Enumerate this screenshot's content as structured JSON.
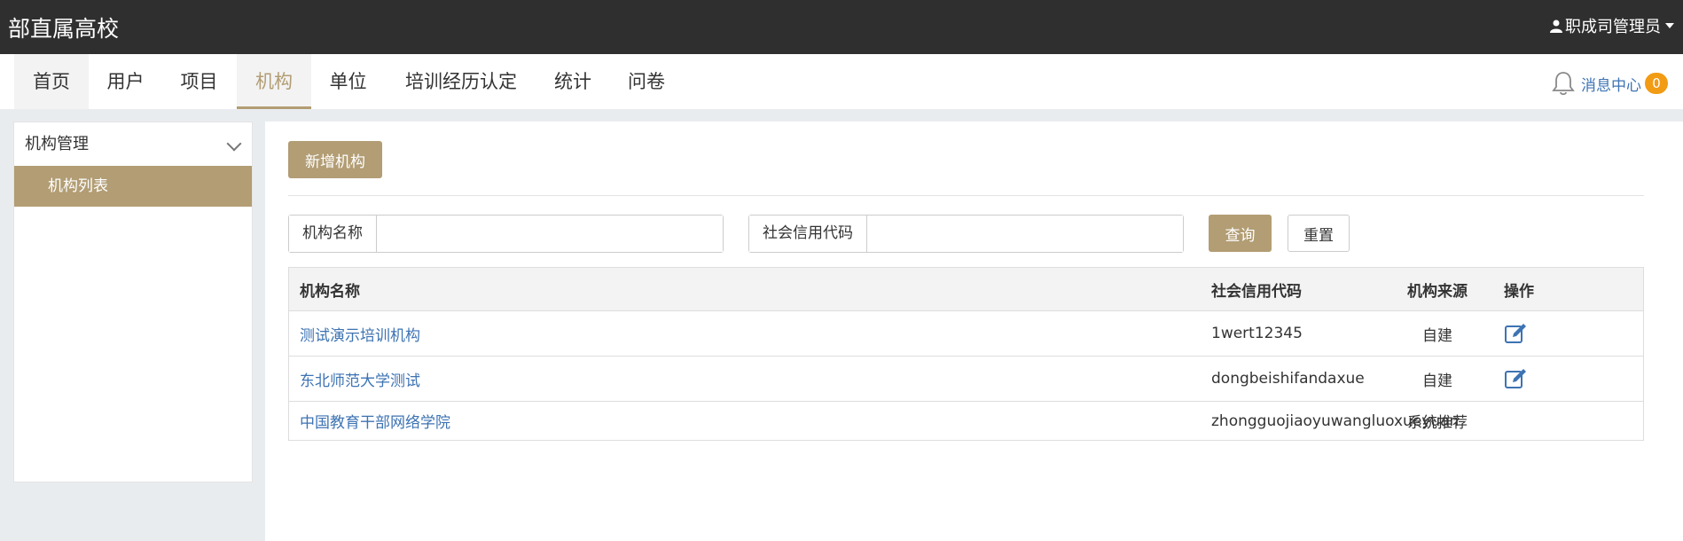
{
  "app": {
    "title": "部直属高校",
    "user": "职成司管理员"
  },
  "nav": {
    "items": [
      {
        "label": "首页"
      },
      {
        "label": "用户"
      },
      {
        "label": "项目"
      },
      {
        "label": "机构"
      },
      {
        "label": "单位"
      },
      {
        "label": "培训经历认定"
      },
      {
        "label": "统计"
      },
      {
        "label": "问卷"
      }
    ],
    "active": "机构",
    "message_center": "消息中心",
    "message_count": "0"
  },
  "sidebar": {
    "group": "机构管理",
    "items": [
      {
        "label": "机构列表"
      }
    ]
  },
  "toolbar": {
    "add_label": "新增机构"
  },
  "search": {
    "name_label": "机构名称",
    "name_value": "",
    "code_label": "社会信用代码",
    "code_value": "",
    "query_label": "查询",
    "reset_label": "重置"
  },
  "table": {
    "headers": {
      "name": "机构名称",
      "code": "社会信用代码",
      "source": "机构来源",
      "action": "操作"
    },
    "rows": [
      {
        "name": "测试演示培训机构",
        "code": "1wert12345",
        "source": "自建",
        "editable": true
      },
      {
        "name": "东北师范大学测试",
        "code": "dongbeishifandaxue",
        "source": "自建",
        "editable": true
      },
      {
        "name": "中国教育干部网络学院",
        "code": "zhongguojiaoyuwangluoxueyuan",
        "source": "系统推荐",
        "editable": false
      }
    ]
  },
  "colors": {
    "accent": "#b29d74",
    "link": "#3d73b3",
    "badge": "#f29b14",
    "topbar": "#2f2f2f"
  },
  "icons": {
    "user": "user-icon",
    "bell": "bell-icon",
    "edit": "edit-icon",
    "chevron": "chevron-down-icon"
  }
}
